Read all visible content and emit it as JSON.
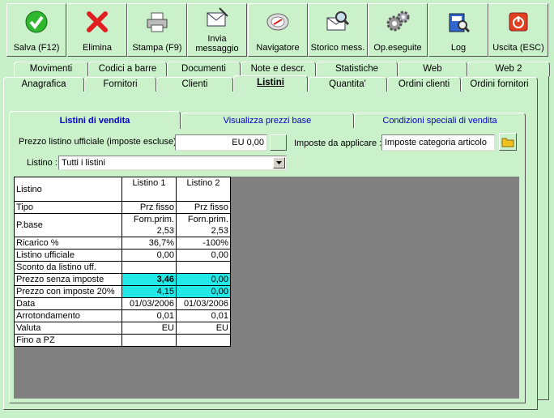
{
  "toolbar": {
    "save": "Salva (F12)",
    "delete": "Elimina",
    "print": "Stampa (F9)",
    "send_line1": "Invia",
    "send_line2": "messaggio",
    "navigator": "Navigatore",
    "history": "Storico mess.",
    "done": "Op.eseguite",
    "log": "Log",
    "exit": "Uscita (ESC)"
  },
  "tabs_row1": [
    "Movimenti",
    "Codici a barre",
    "Documenti",
    "Note e descr.",
    "Statistiche",
    "Web",
    "Web 2"
  ],
  "tabs_row2": [
    "Anagrafica",
    "Fornitori",
    "Clienti",
    "Listini",
    "Quantita'",
    "Ordini clienti",
    "Ordini fornitori"
  ],
  "subtabs": [
    "Listini di vendita",
    "Visualizza prezzi base",
    "Condizioni speciali di vendita"
  ],
  "form": {
    "official_price_label": "Prezzo listino ufficiale (imposte escluse) :",
    "official_price_value": "EU 0,00",
    "taxes_label": "Imposte da applicare :",
    "taxes_value": "Imposte categoria articolo",
    "list_label": "Listino :",
    "list_value": "Tutti i listini"
  },
  "grid": {
    "header_label": "Listino",
    "columns": [
      "Listino 1",
      "Listino 2"
    ],
    "rows": [
      {
        "label": "Tipo",
        "v1": "Prz fisso",
        "v2": "Prz fisso"
      },
      {
        "label": "P.base",
        "v1a": "Forn.prim.",
        "v1b": "2,53",
        "v2a": "Forn.prim.",
        "v2b": "2,53"
      },
      {
        "label": "Ricarico %",
        "v1": "36,7%",
        "v2": "-100%"
      },
      {
        "label": "Listino ufficiale",
        "v1": "0,00",
        "v2": "0,00"
      },
      {
        "label": "Sconto da listino uff.",
        "v1": "",
        "v2": ""
      },
      {
        "label": "Prezzo senza imposte",
        "v1": "3,46",
        "v2": "0,00"
      },
      {
        "label": "Prezzo con imposte 20%",
        "v1": "4,15",
        "v2": "0,00"
      },
      {
        "label": "Data",
        "v1": "01/03/2006",
        "v2": "01/03/2006"
      },
      {
        "label": "Arrotondamento",
        "v1": "0,01",
        "v2": "0,01"
      },
      {
        "label": "Valuta",
        "v1": "EU",
        "v2": "EU"
      },
      {
        "label": "Fino a PZ",
        "v1": "",
        "v2": ""
      }
    ]
  },
  "colors": {
    "background": "#c8f0c8",
    "highlight": "#22e8e8",
    "grid_area": "#808080",
    "link": "#0000cc"
  }
}
